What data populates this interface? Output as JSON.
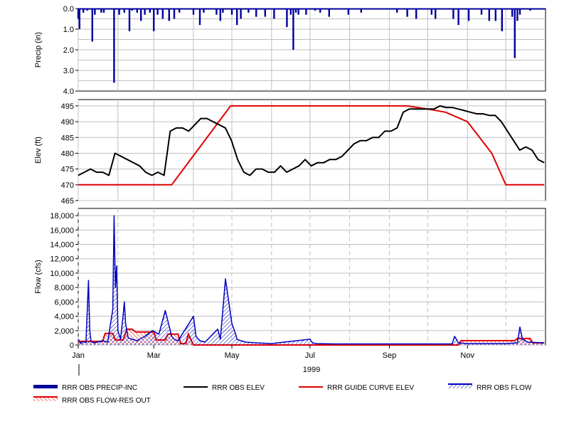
{
  "colors": {
    "precip": "#0000a0",
    "obs_elev": "#000000",
    "guide_curve": "#e00000",
    "obs_flow": "#0000c0",
    "flow_res_out": "#e00000",
    "grid": "#c0c0c0",
    "frame": "#000000"
  },
  "chart_data": [
    {
      "type": "bar",
      "panel": "precip",
      "xlabel": "",
      "ylabel": "Precip (in)",
      "y_inverted": true,
      "ylim": [
        0,
        4.0
      ],
      "yticks": [
        "0.0",
        "1.0",
        "2.0",
        "3.0",
        "4.0"
      ],
      "grid": true,
      "series": [
        {
          "name": "RRR OBS PRECIP-INC",
          "dates": [
            "1999-01-01",
            "1999-01-02",
            "1999-01-05",
            "1999-01-08",
            "1999-01-12",
            "1999-01-14",
            "1999-01-19",
            "1999-01-21",
            "1999-01-29",
            "1999-02-02",
            "1999-02-06",
            "1999-02-10",
            "1999-02-12",
            "1999-02-16",
            "1999-02-19",
            "1999-02-22",
            "1999-02-26",
            "1999-03-01",
            "1999-03-04",
            "1999-03-08",
            "1999-03-13",
            "1999-03-17",
            "1999-03-21",
            "1999-04-01",
            "1999-04-06",
            "1999-04-09",
            "1999-04-19",
            "1999-04-22",
            "1999-04-24",
            "1999-05-01",
            "1999-05-05",
            "1999-05-08",
            "1999-05-14",
            "1999-05-20",
            "1999-05-27",
            "1999-06-03",
            "1999-06-13",
            "1999-06-16",
            "1999-06-18",
            "1999-06-20",
            "1999-06-22",
            "1999-06-28",
            "1999-07-05",
            "1999-07-09",
            "1999-07-16",
            "1999-07-31",
            "1999-08-10",
            "1999-09-07",
            "1999-09-15",
            "1999-09-22",
            "1999-10-04",
            "1999-10-07",
            "1999-10-21",
            "1999-10-25",
            "1999-11-02",
            "1999-11-12",
            "1999-11-18",
            "1999-11-23",
            "1999-11-28",
            "1999-12-06",
            "1999-12-08",
            "1999-12-10",
            "1999-12-12",
            "1999-12-20"
          ],
          "values": [
            0.5,
            1.0,
            0.2,
            0.1,
            1.6,
            0.3,
            0.2,
            0.2,
            3.6,
            0.3,
            0.2,
            1.1,
            0.1,
            0.2,
            0.6,
            0.3,
            0.2,
            1.1,
            0.3,
            0.5,
            0.6,
            0.5,
            0.2,
            0.3,
            0.8,
            0.2,
            0.3,
            0.6,
            0.2,
            0.3,
            0.8,
            0.5,
            0.2,
            0.4,
            0.4,
            0.5,
            0.9,
            0.3,
            2.0,
            0.2,
            0.3,
            0.3,
            0.1,
            0.2,
            0.4,
            0.3,
            0.2,
            0.2,
            0.4,
            0.5,
            0.3,
            0.5,
            0.5,
            0.8,
            0.6,
            0.3,
            0.6,
            0.6,
            1.1,
            0.4,
            2.4,
            0.6,
            0.3,
            0.1
          ]
        }
      ]
    },
    {
      "type": "line",
      "panel": "elevation",
      "xlabel": "",
      "ylabel": "Elev (ft)",
      "ylim": [
        465,
        497
      ],
      "yticks": [
        "465",
        "470",
        "475",
        "480",
        "485",
        "490",
        "495"
      ],
      "grid": true,
      "series": [
        {
          "name": "RRR OBS ELEV",
          "dates": [
            "1999-01-01",
            "1999-01-03",
            "1999-01-06",
            "1999-01-08",
            "1999-01-10",
            "1999-01-14",
            "1999-01-19",
            "1999-01-28",
            "1999-01-30",
            "1999-02-01",
            "1999-02-03",
            "1999-02-07",
            "1999-02-10",
            "1999-02-12",
            "1999-02-16",
            "1999-02-21",
            "1999-02-26",
            "1999-03-01",
            "1999-03-04",
            "1999-03-08",
            "1999-03-10",
            "1999-03-12",
            "1999-03-15",
            "1999-03-18",
            "1999-03-20",
            "1999-03-23",
            "1999-03-26",
            "1999-03-28",
            "1999-04-01",
            "1999-04-05",
            "1999-04-09",
            "1999-04-15",
            "1999-04-21",
            "1999-04-24",
            "1999-04-29",
            "1999-05-04",
            "1999-05-06",
            "1999-05-09",
            "1999-05-12",
            "1999-05-15",
            "1999-05-22",
            "1999-06-01",
            "1999-06-15",
            "1999-07-01",
            "1999-07-05",
            "1999-08-01",
            "1999-09-01",
            "1999-10-01",
            "1999-10-15",
            "1999-10-25",
            "1999-11-15",
            "1999-12-05",
            "1999-12-15",
            "1999-12-21",
            "1999-12-23",
            "1999-12-26",
            "1999-12-31"
          ],
          "values": [
            473,
            474,
            475,
            474,
            474,
            473,
            480,
            479,
            478,
            477,
            476,
            474,
            473,
            474,
            473,
            487,
            488,
            488,
            487,
            489,
            491,
            491,
            490,
            489,
            488,
            484,
            478,
            474,
            473,
            475,
            475,
            474,
            474,
            476,
            474,
            475,
            476,
            478,
            476,
            477,
            477,
            478,
            478,
            479,
            481,
            483,
            484,
            484,
            485,
            485,
            487,
            487,
            488,
            493,
            494,
            494,
            494,
            494,
            494,
            495,
            494.5,
            494.5,
            494,
            493.5,
            493,
            492.5,
            492.5,
            492,
            492,
            490,
            487,
            484,
            481,
            482,
            481,
            478,
            477
          ]
        },
        {
          "name": "RRR GUIDE CURVE ELEV",
          "dates": [
            "1999-01-01",
            "1999-03-15",
            "1999-04-30",
            "1999-09-15",
            "1999-10-01",
            "1999-10-15",
            "1999-11-01",
            "1999-11-20",
            "1999-12-01",
            "1999-12-31"
          ],
          "values": [
            470,
            470,
            495,
            495,
            494,
            493,
            490,
            480,
            470,
            470
          ]
        }
      ]
    },
    {
      "type": "line",
      "panel": "flow",
      "xlabel": "1999",
      "ylabel": "Flow (cfs)",
      "ylim": [
        0,
        19000
      ],
      "yticks": [
        "0",
        "2,000",
        "4,000",
        "6,000",
        "8,000",
        "10,000",
        "12,000",
        "14,000",
        "16,000",
        "18,000"
      ],
      "xticks": [
        "Jan",
        "Mar",
        "May",
        "Jul",
        "Sep",
        "Nov"
      ],
      "grid": true,
      "series": [
        {
          "name": "RRR OBS FLOW",
          "dates": [
            "1999-01-01",
            "1999-01-03",
            "1999-01-05",
            "1999-01-07",
            "1999-01-09",
            "1999-01-10",
            "1999-01-11",
            "1999-01-13",
            "1999-01-16",
            "1999-01-20",
            "1999-01-24",
            "1999-01-28",
            "1999-01-29",
            "1999-01-30",
            "1999-01-31",
            "1999-02-01",
            "1999-02-03",
            "1999-02-05",
            "1999-02-06",
            "1999-02-07",
            "1999-02-09",
            "1999-02-12",
            "1999-02-16",
            "1999-02-22",
            "1999-02-28",
            "1999-03-05",
            "1999-03-10",
            "1999-03-15",
            "1999-03-17",
            "1999-03-20",
            "1999-04-01",
            "1999-04-03",
            "1999-04-06",
            "1999-04-10",
            "1999-04-20",
            "1999-04-22",
            "1999-04-26",
            "1999-05-01",
            "1999-05-04",
            "1999-05-05",
            "1999-05-08",
            "1999-05-12",
            "1999-05-20",
            "1999-06-01",
            "1999-07-01",
            "1999-07-03",
            "1999-07-06",
            "1999-07-20",
            "1999-09-01",
            "1999-10-20",
            "1999-10-22",
            "1999-10-25",
            "1999-11-01",
            "1999-12-01",
            "1999-12-10",
            "1999-12-12",
            "1999-12-14",
            "1999-12-18",
            "1999-12-31"
          ],
          "values": [
            800,
            200,
            500,
            300,
            9000,
            2000,
            500,
            300,
            400,
            600,
            400,
            5000,
            18000,
            8000,
            11000,
            2000,
            800,
            4000,
            6000,
            3000,
            1000,
            800,
            600,
            1200,
            2000,
            1500,
            4800,
            1200,
            800,
            600,
            4000,
            1200,
            600,
            400,
            2200,
            800,
            9200,
            3000,
            1500,
            800,
            600,
            400,
            300,
            200,
            800,
            300,
            200,
            150,
            150,
            150,
            1200,
            300,
            200,
            200,
            300,
            2500,
            800,
            400,
            300
          ]
        },
        {
          "name": "RRR OBS FLOW-RES OUT",
          "dates": [
            "1999-01-01",
            "1999-01-20",
            "1999-01-22",
            "1999-01-28",
            "1999-01-30",
            "1999-02-05",
            "1999-02-08",
            "1999-02-12",
            "1999-02-15",
            "1999-03-01",
            "1999-03-03",
            "1999-03-10",
            "1999-03-12",
            "1999-03-20",
            "1999-03-22",
            "1999-03-26",
            "1999-03-28",
            "1999-04-01",
            "1999-10-25",
            "1999-10-27",
            "1999-12-08",
            "1999-12-10",
            "1999-12-20",
            "1999-12-22",
            "1999-12-31"
          ],
          "values": [
            500,
            500,
            1600,
            1600,
            700,
            700,
            2200,
            2200,
            1800,
            1800,
            700,
            700,
            1500,
            1500,
            200,
            200,
            1500,
            0,
            0,
            600,
            600,
            900,
            900,
            300,
            300
          ]
        }
      ]
    }
  ],
  "legend": [
    {
      "name": "RRR OBS PRECIP-INC",
      "style": "thick-bar"
    },
    {
      "name": "RRR OBS ELEV",
      "style": "line"
    },
    {
      "name": "RRR GUIDE CURVE ELEV",
      "style": "line"
    },
    {
      "name": "RRR OBS FLOW",
      "style": "hatched"
    },
    {
      "name": "RRR OBS FLOW-RES OUT",
      "style": "hatched"
    }
  ]
}
